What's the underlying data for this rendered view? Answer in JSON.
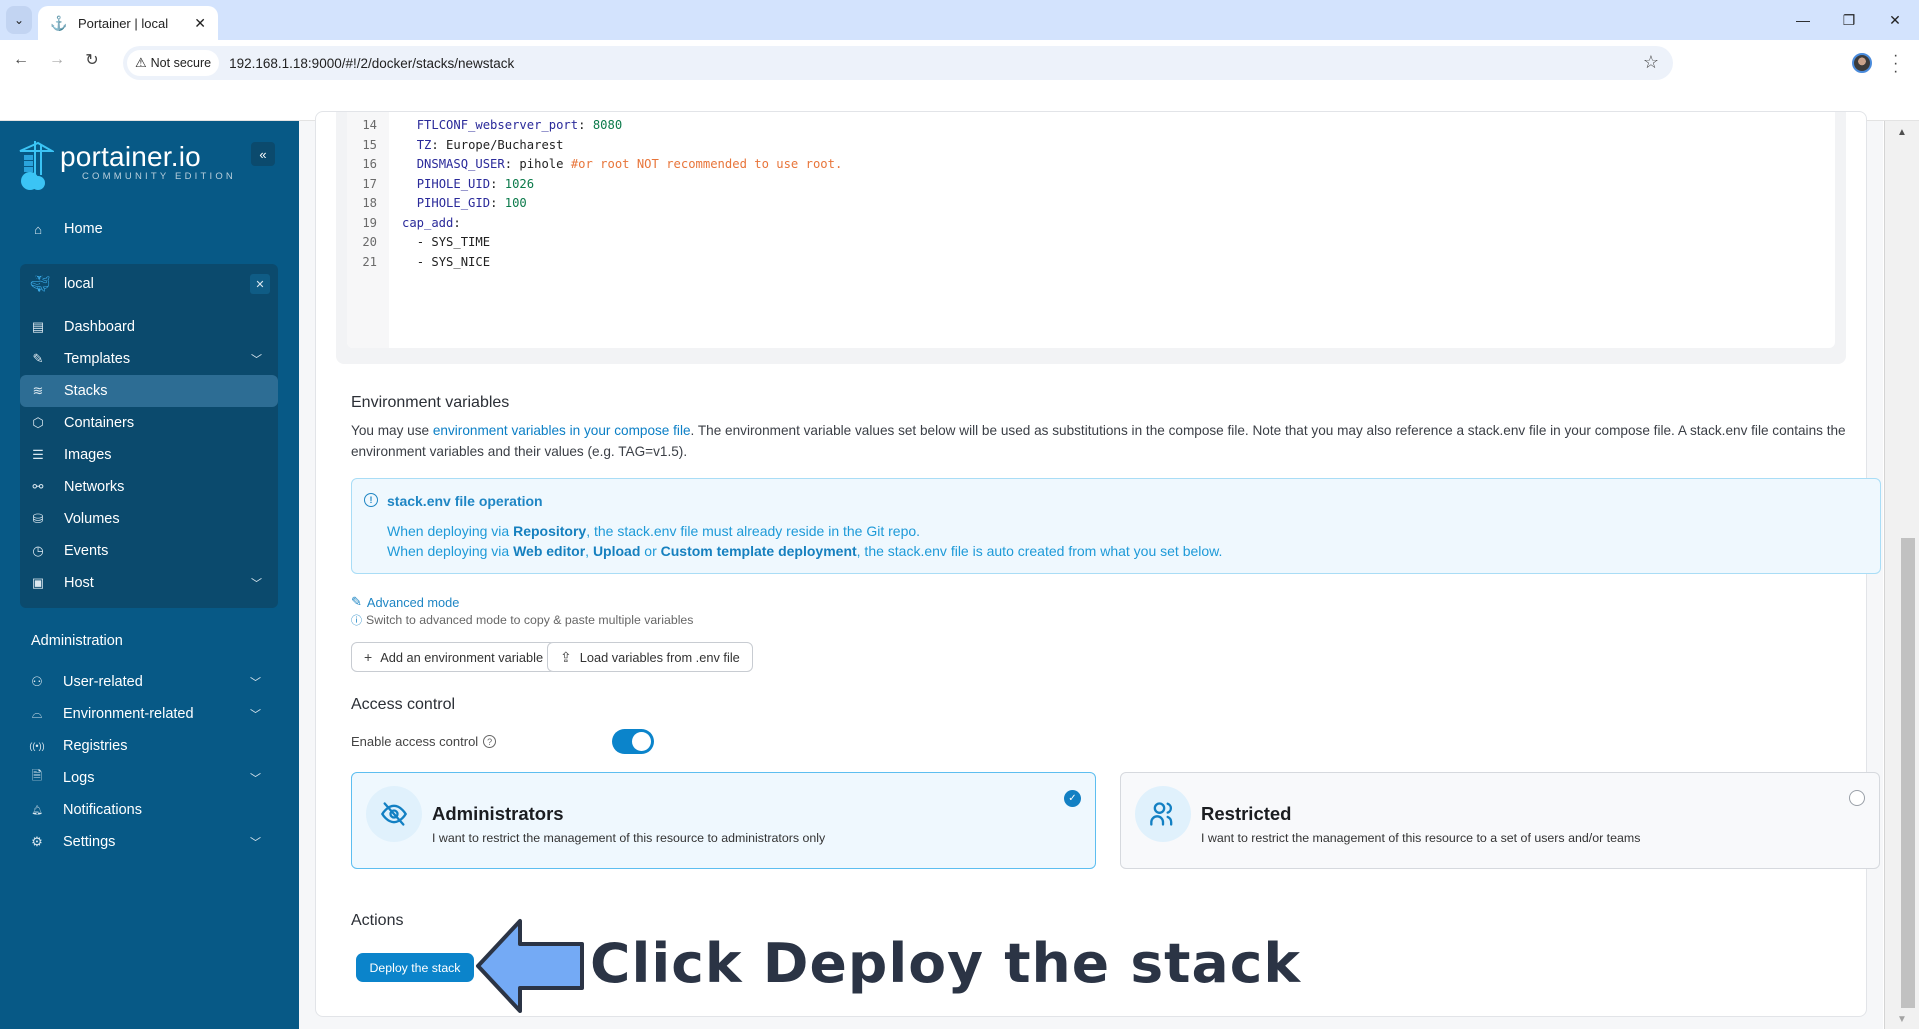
{
  "browser": {
    "tab_title": "Portainer | local",
    "security_label": "Not secure",
    "url": "192.168.1.18:9000/#!/2/docker/stacks/newstack"
  },
  "sidebar": {
    "logo_name": "portainer.io",
    "logo_edition": "COMMUNITY EDITION",
    "home_label": "Home",
    "environment": {
      "name": "local",
      "items": [
        {
          "label": "Dashboard",
          "icon": "dashboard-icon",
          "glyph": "▤",
          "expandable": false,
          "active": false
        },
        {
          "label": "Templates",
          "icon": "edit-icon",
          "glyph": "✎",
          "expandable": true,
          "active": false
        },
        {
          "label": "Stacks",
          "icon": "layers-icon",
          "glyph": "≋",
          "expandable": false,
          "active": true
        },
        {
          "label": "Containers",
          "icon": "box-icon",
          "glyph": "⬡",
          "expandable": false,
          "active": false
        },
        {
          "label": "Images",
          "icon": "list-icon",
          "glyph": "☰",
          "expandable": false,
          "active": false
        },
        {
          "label": "Networks",
          "icon": "network-icon",
          "glyph": "⚯",
          "expandable": false,
          "active": false
        },
        {
          "label": "Volumes",
          "icon": "database-icon",
          "glyph": "⛁",
          "expandable": false,
          "active": false
        },
        {
          "label": "Events",
          "icon": "clock-icon",
          "glyph": "◷",
          "expandable": false,
          "active": false
        },
        {
          "label": "Host",
          "icon": "host-icon",
          "glyph": "▣",
          "expandable": true,
          "active": false
        }
      ]
    },
    "admin_heading": "Administration",
    "admin_items": [
      {
        "label": "User-related",
        "icon": "users-icon",
        "glyph": "⚇",
        "expandable": true
      },
      {
        "label": "Environment-related",
        "icon": "server-icon",
        "glyph": "⌓",
        "expandable": true
      },
      {
        "label": "Registries",
        "icon": "radio-icon",
        "glyph": "((•))",
        "expandable": false
      },
      {
        "label": "Logs",
        "icon": "file-icon",
        "glyph": "🗎",
        "expandable": true
      },
      {
        "label": "Notifications",
        "icon": "bell-icon",
        "glyph": "🔔︎",
        "expandable": false
      },
      {
        "label": "Settings",
        "icon": "gear-icon",
        "glyph": "⚙",
        "expandable": true
      }
    ]
  },
  "editor": {
    "lines": [
      {
        "n": "14",
        "indent": 6,
        "key": "FTLCONF_webserver_port",
        "value": "",
        "num": "8080",
        "comment": ""
      },
      {
        "n": "15",
        "indent": 6,
        "key": "TZ",
        "value": "Europe/Bucharest",
        "num": "",
        "comment": ""
      },
      {
        "n": "16",
        "indent": 6,
        "key": "DNSMASQ_USER",
        "value": "pihole",
        "num": "",
        "comment": "#or root NOT recommended to use root."
      },
      {
        "n": "17",
        "indent": 6,
        "key": "PIHOLE_UID",
        "value": "",
        "num": "1026",
        "comment": ""
      },
      {
        "n": "18",
        "indent": 6,
        "key": "PIHOLE_GID",
        "value": "",
        "num": "100",
        "comment": ""
      },
      {
        "n": "19",
        "indent": 4,
        "key": "cap_add",
        "value": "",
        "num": "",
        "comment": ""
      },
      {
        "n": "20",
        "indent": 6,
        "key": "",
        "value": "- SYS_TIME",
        "num": "",
        "comment": ""
      },
      {
        "n": "21",
        "indent": 6,
        "key": "",
        "value": "- SYS_NICE",
        "num": "",
        "comment": ""
      }
    ]
  },
  "env_vars": {
    "title": "Environment variables",
    "desc_before": "You may use ",
    "desc_link": "environment variables in your compose file",
    "desc_after": ". The environment variable values set below will be used as substitutions in the compose file. Note that you may also reference a stack.env file in your compose file. A stack.env file contains the environment variables and their values (e.g. TAG=v1.5).",
    "info_title": "stack.env file operation",
    "info_line1": {
      "a": "When deploying via ",
      "b1": "Repository",
      "c": ", the stack.env file must already reside in the Git repo."
    },
    "info_line2": {
      "a": "When deploying via ",
      "b1": "Web editor",
      "s1": ", ",
      "b2": "Upload",
      "s2": " or ",
      "b3": "Custom template deployment",
      "c": ", the stack.env file is auto created from what you set below."
    },
    "advanced_mode": "Advanced mode",
    "advanced_hint": "Switch to advanced mode to copy & paste multiple variables",
    "add_button": "Add an environment variable",
    "load_button": "Load variables from .env file"
  },
  "access_control": {
    "title": "Access control",
    "enable_label": "Enable access control",
    "enabled": true,
    "options": [
      {
        "title": "Administrators",
        "desc": "I want to restrict the management of this resource to administrators only",
        "selected": true
      },
      {
        "title": "Restricted",
        "desc": "I want to restrict the management of this resource to a set of users and/or teams",
        "selected": false
      }
    ]
  },
  "actions": {
    "title": "Actions",
    "deploy_button": "Deploy the stack"
  },
  "annotation": {
    "text": "Click Deploy the stack",
    "arrow_color": "#74aaf5"
  },
  "colors": {
    "sidebar_bg": "#075986",
    "accent": "#0b84cb"
  }
}
